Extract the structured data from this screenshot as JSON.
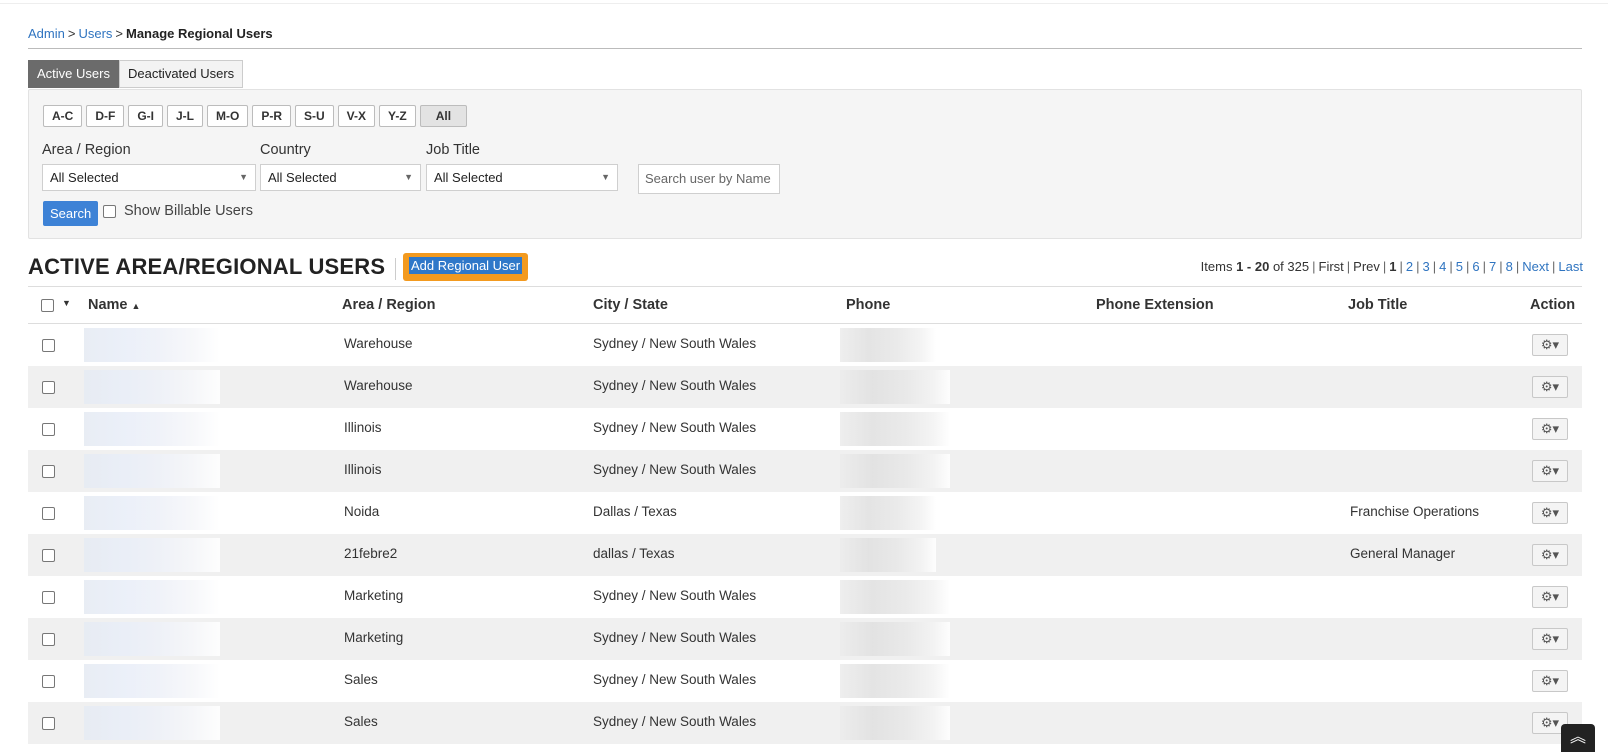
{
  "breadcrumb": {
    "admin": "Admin",
    "users": "Users",
    "sep": ">",
    "current": "Manage Regional Users"
  },
  "tabs": [
    {
      "label": "Active Users",
      "active": true
    },
    {
      "label": "Deactivated Users",
      "active": false
    }
  ],
  "alpha_filters": [
    "A-C",
    "D-F",
    "G-I",
    "J-L",
    "M-O",
    "P-R",
    "S-U",
    "V-X",
    "Y-Z",
    "All"
  ],
  "filters": {
    "area_label": "Area / Region",
    "area_value": "All Selected",
    "country_label": "Country",
    "country_value": "All Selected",
    "job_label": "Job Title",
    "job_value": "All Selected",
    "search_placeholder": "Search user by Name",
    "search_button": "Search",
    "billable_label": "Show Billable Users"
  },
  "section": {
    "title": "ACTIVE AREA/REGIONAL USERS",
    "add_button": "Add Regional User"
  },
  "pager": {
    "items_prefix": "Items",
    "range": "1 - 20",
    "of_total": "of 325",
    "first": "First",
    "prev": "Prev",
    "current": "1",
    "pages": [
      "2",
      "3",
      "4",
      "5",
      "6",
      "7",
      "8"
    ],
    "next": "Next",
    "last": "Last"
  },
  "table": {
    "headers": {
      "name": "Name",
      "area": "Area / Region",
      "city": "City / State",
      "phone": "Phone",
      "ext": "Phone Extension",
      "job": "Job Title",
      "action": "Action"
    },
    "rows": [
      {
        "area": "Warehouse",
        "city": "Sydney / New South Wales",
        "job": ""
      },
      {
        "area": "Warehouse",
        "city": "Sydney / New South Wales",
        "job": ""
      },
      {
        "area": "Illinois",
        "city": "Sydney / New South Wales",
        "job": ""
      },
      {
        "area": "Illinois",
        "city": "Sydney / New South Wales",
        "job": ""
      },
      {
        "area": "Noida",
        "city": "Dallas / Texas",
        "job": "Franchise Operations"
      },
      {
        "area": "21febre2",
        "city": "dallas / Texas",
        "job": "General Manager"
      },
      {
        "area": "Marketing",
        "city": "Sydney / New South Wales",
        "job": ""
      },
      {
        "area": "Marketing",
        "city": "Sydney / New South Wales",
        "job": ""
      },
      {
        "area": "Sales",
        "city": "Sydney / New South Wales",
        "job": ""
      },
      {
        "area": "Sales",
        "city": "Sydney / New South Wales",
        "job": ""
      }
    ]
  },
  "icons": {
    "gear": "gear-icon",
    "caret": "caret-down-icon",
    "sort": "sort-asc-icon",
    "scroll_top": "double-chevron-up-icon"
  },
  "colors": {
    "link": "#2f74c0",
    "primary": "#3d82d6",
    "accent": "#f39a1f",
    "active_tab": "#6b6b6b"
  }
}
